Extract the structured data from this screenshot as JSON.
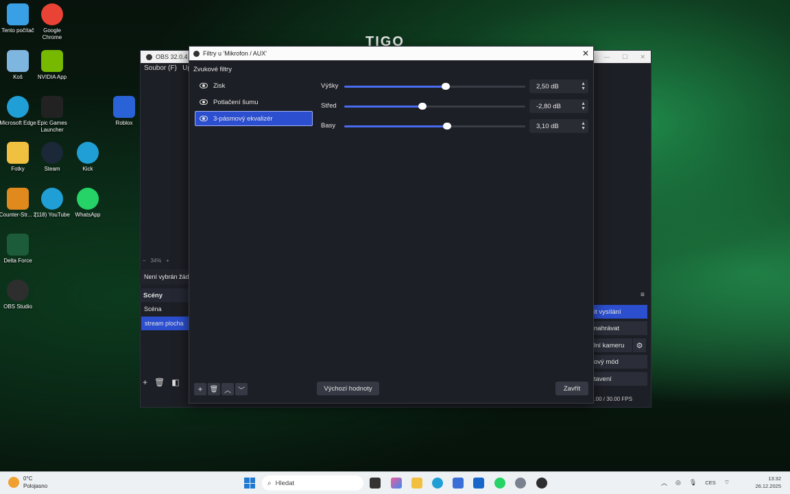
{
  "desktop": {
    "icons": [
      {
        "label": "Tento počítač",
        "icon": "monitor-icon",
        "color": "#3aa0e6"
      },
      {
        "label": "Google Chrome",
        "icon": "chrome-icon",
        "color": "#e94335"
      },
      {
        "label": "Koš",
        "icon": "recycle-bin-icon",
        "color": "#7fb6e0"
      },
      {
        "label": "NVIDIA App",
        "icon": "nvidia-icon",
        "color": "#76b900"
      },
      {
        "label": "Microsoft Edge",
        "icon": "edge-icon",
        "color": "#1f9fd6"
      },
      {
        "label": "Epic Games Launcher",
        "icon": "epic-games-icon",
        "color": "#222222"
      },
      {
        "label": "Roblox",
        "icon": "roblox-icon",
        "color": "#2a63d8"
      },
      {
        "label": "Fotky",
        "icon": "folder-icon",
        "color": "#f0c040"
      },
      {
        "label": "Steam",
        "icon": "steam-icon",
        "color": "#1b2838"
      },
      {
        "label": "Kick",
        "icon": "edge-icon",
        "color": "#1f9fd6"
      },
      {
        "label": "Counter-Str... 2",
        "icon": "cs2-icon",
        "color": "#e08a1e"
      },
      {
        "label": "(118) YouTube",
        "icon": "edge-icon",
        "color": "#1f9fd6"
      },
      {
        "label": "WhatsApp",
        "icon": "whatsapp-icon",
        "color": "#25d366"
      },
      {
        "label": "Delta Force",
        "icon": "delta-force-icon",
        "color": "#1c5c3a"
      },
      {
        "label": "OBS Studio",
        "icon": "obs-icon",
        "color": "#2e2e2e"
      }
    ],
    "watermark": "TIGO"
  },
  "obs_main": {
    "title": "OBS 32.0.4 -",
    "menu": [
      "Soubor (F)",
      "Up"
    ],
    "zoom": "34%",
    "no_source": "Není vybrán žád",
    "scenes_header": "Scény",
    "scenes": [
      "Scéna",
      "stream plocha"
    ],
    "controls": [
      "it vysílání",
      "nahrávat",
      "lní kameru",
      "ový mód",
      "tavení"
    ],
    "fps": "0.00 / 30.00 FPS"
  },
  "dialog": {
    "title": "Filtry u 'Mikrofon / AUX'",
    "section_label": "Zvukové filtry",
    "filters": [
      {
        "label": "Zisk",
        "selected": false
      },
      {
        "label": "Potlačení šumu",
        "selected": false
      },
      {
        "label": "3-pásmový ekvalizér",
        "selected": true
      }
    ],
    "bands": [
      {
        "label": "Výšky",
        "value": "2,50 dB",
        "level": 0.56
      },
      {
        "label": "Střed",
        "value": "-2,80 dB",
        "level": 0.43
      },
      {
        "label": "Basy",
        "value": "3,10 dB",
        "level": 0.57
      }
    ],
    "defaults_button": "Výchozí hodnoty",
    "close_button": "Zavřít"
  },
  "taskbar": {
    "weather_temp": "0°C",
    "weather_desc": "Polojasno",
    "search_placeholder": "Hledat",
    "lang": "CES",
    "time": "13:32",
    "date": "26.12.2025"
  }
}
